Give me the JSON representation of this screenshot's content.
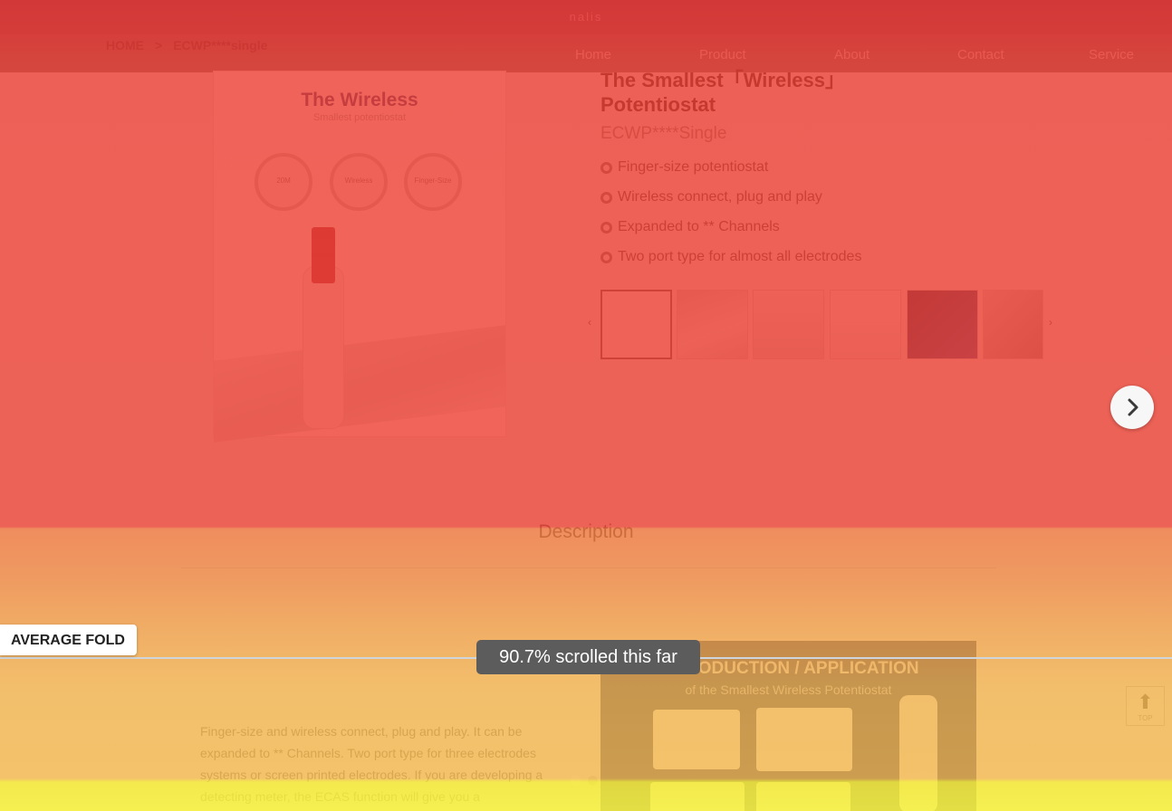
{
  "site": {
    "logo_text": "nalis",
    "breadcrumb": [
      "HOME",
      ">",
      "ECWP****single"
    ],
    "nav": [
      "Home",
      "Product",
      "About",
      "Contact",
      "Service"
    ]
  },
  "product": {
    "image_title": "The Wireless",
    "image_subtitle": "Smallest potentiostat",
    "badges": [
      "20M",
      "Wireless",
      "Finger-Size"
    ],
    "title": "The Smallest「Wireless」Potentiostat",
    "model": "ECWP****Single",
    "features": [
      "Finger-size potentiostat",
      "Wireless connect, plug and play",
      "Expanded to ** Channels",
      "Two port type for almost all electrodes"
    ],
    "thumbnail_arrows": [
      "‹",
      "›"
    ]
  },
  "description": {
    "heading": "Description",
    "text": "Finger-size and wireless connect, plug and play. It can be expanded to ** Channels. Two port type for three electrodes systems or screen printed electrodes. If you are developing a detecting meter, the ECAS function will give you a",
    "intro_title": "INTRODUCTION / APPLICATION",
    "intro_subtitle": "of the Smallest Wireless Potentiostat"
  },
  "top_button": {
    "label": "TOP",
    "arrow": "⬆"
  },
  "heatmap": {
    "fold_label": "AVERAGE FOLD",
    "scroll_text": "90.7% scrolled this far",
    "scroll_percent": 90.7,
    "colors": {
      "hot": "#e62e2e",
      "warm": "#f0a040",
      "cool": "#f4ec3c"
    }
  },
  "carousel": {
    "dot_count": 2,
    "active_dot": 0
  }
}
